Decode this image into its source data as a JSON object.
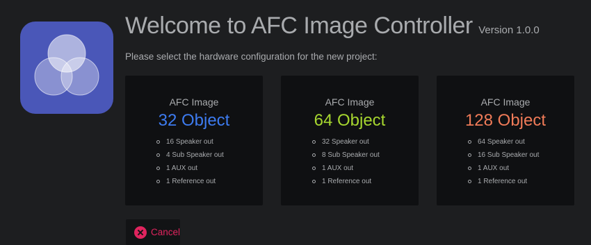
{
  "header": {
    "title": "Welcome to AFC Image Controller",
    "version": "Version 1.0.0",
    "subtitle": "Please select the hardware configuration for the new project:"
  },
  "logo": {
    "icon": "overlapping-circles-logo-icon"
  },
  "cards": [
    {
      "label": "AFC Image",
      "count": "32 Object",
      "color": "#3d7bf0",
      "features": [
        "16 Speaker out",
        "4 Sub Speaker out",
        "1 AUX out",
        "1 Reference out"
      ]
    },
    {
      "label": "AFC Image",
      "count": "64 Object",
      "color": "#a6d62f",
      "features": [
        "32 Speaker out",
        "8 Sub Speaker out",
        "1 AUX out",
        "1 Reference out"
      ]
    },
    {
      "label": "AFC Image",
      "count": "128 Object",
      "color": "#f07b58",
      "features": [
        "64 Speaker out",
        "16 Sub Speaker out",
        "1 AUX out",
        "1 Reference out"
      ]
    }
  ],
  "cancel": {
    "label": "Cancel",
    "icon": "close-circle-icon",
    "color": "#e0245e"
  },
  "colors": {
    "background": "#1d1e20",
    "card_background": "#0f1012",
    "text": "#a9abae",
    "logo_background": "#4a57b8"
  }
}
